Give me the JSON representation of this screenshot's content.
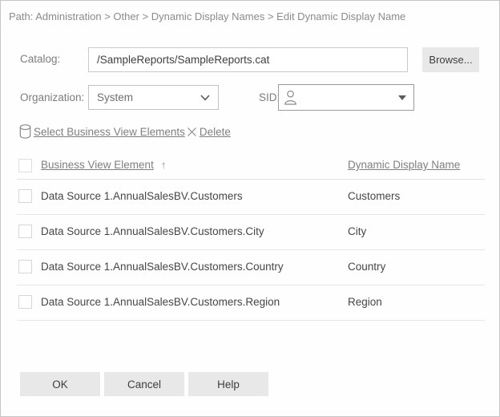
{
  "breadcrumb": "Path: Administration > Other > Dynamic Display Names > Edit Dynamic Display Name",
  "catalog": {
    "label": "Catalog:",
    "value": "/SampleReports/SampleReports.cat",
    "browse_label": "Browse..."
  },
  "organization": {
    "label": "Organization:",
    "selected": "System"
  },
  "sid": {
    "label": "SID:",
    "value": ""
  },
  "toolbar": {
    "select_elements_label": "Select Business View Elements",
    "delete_label": "Delete"
  },
  "table": {
    "columns": [
      "Business View Element",
      "Dynamic Display Name"
    ],
    "sort": {
      "column": "Business View Element",
      "direction": "ascending",
      "glyph": "↑"
    },
    "rows": [
      {
        "element": "Data Source 1.AnnualSalesBV.Customers",
        "display_name": "Customers"
      },
      {
        "element": "Data Source 1.AnnualSalesBV.Customers.City",
        "display_name": "City"
      },
      {
        "element": "Data Source 1.AnnualSalesBV.Customers.Country",
        "display_name": "Country"
      },
      {
        "element": "Data Source 1.AnnualSalesBV.Customers.Region",
        "display_name": "Region"
      }
    ]
  },
  "footer": {
    "ok_label": "OK",
    "cancel_label": "Cancel",
    "help_label": "Help"
  },
  "colors": {
    "muted_text": "#8b8b8b",
    "dark_text": "#464646",
    "input_border": "#c9c9c9",
    "button_bg": "#e8e8e8",
    "separator": "#e7e7e7"
  }
}
